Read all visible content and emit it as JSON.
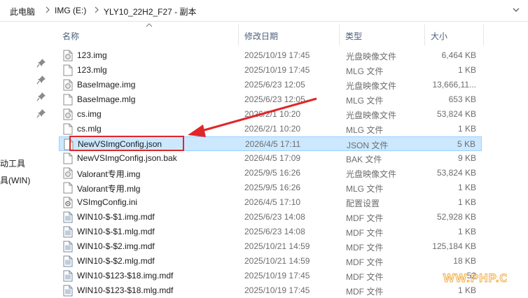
{
  "address_bar": {
    "crumbs": [
      "此电脑",
      "IMG (E:)",
      "YLY10_22H2_F27 - 副本"
    ],
    "separator_icon": "chevron-right-icon",
    "dropdown_icon": "chevron-down-icon"
  },
  "nav_pane": {
    "items": [
      "启动工具",
      "工具(WIN)"
    ],
    "pin_icon": "pin-icon"
  },
  "columns": {
    "name": "名称",
    "date": "修改日期",
    "type": "类型",
    "size": "大小"
  },
  "files": [
    {
      "name": "123.img",
      "date": "2025/10/19 17:45",
      "type": "光盘映像文件",
      "size": "6,464 KB",
      "icon": "disc-image-file-icon"
    },
    {
      "name": "123.mlg",
      "date": "2025/10/19 17:45",
      "type": "MLG 文件",
      "size": "1 KB",
      "icon": "blank-file-icon"
    },
    {
      "name": "BaseImage.img",
      "date": "2025/6/23 12:05",
      "type": "光盘映像文件",
      "size": "13,666,11...",
      "icon": "disc-image-file-icon"
    },
    {
      "name": "BaseImage.mlg",
      "date": "2025/6/23 12:05",
      "type": "MLG 文件",
      "size": "653 KB",
      "icon": "blank-file-icon"
    },
    {
      "name": "cs.img",
      "date": "2026/2/1 10:20",
      "type": "光盘映像文件",
      "size": "53,824 KB",
      "icon": "disc-image-file-icon"
    },
    {
      "name": "cs.mlg",
      "date": "2026/2/1 10:20",
      "type": "MLG 文件",
      "size": "1 KB",
      "icon": "blank-file-icon"
    },
    {
      "name": "NewVSImgConfig.json",
      "date": "2026/4/5 17:11",
      "type": "JSON 文件",
      "size": "5 KB",
      "icon": "blank-file-icon",
      "selected": true
    },
    {
      "name": "NewVSImgConfig.json.bak",
      "date": "2026/4/5 17:09",
      "type": "BAK 文件",
      "size": "9 KB",
      "icon": "blank-file-icon"
    },
    {
      "name": "Valorant专用.img",
      "date": "2025/9/5 16:26",
      "type": "光盘映像文件",
      "size": "53,824 KB",
      "icon": "disc-image-file-icon"
    },
    {
      "name": "Valorant专用.mlg",
      "date": "2025/9/5 16:26",
      "type": "MLG 文件",
      "size": "1 KB",
      "icon": "blank-file-icon"
    },
    {
      "name": "VSImgConfig.ini",
      "date": "2026/4/5 17:10",
      "type": "配置设置",
      "size": "1 KB",
      "icon": "config-file-icon"
    },
    {
      "name": "WIN10-$-$1.img.mdf",
      "date": "2025/6/23 14:08",
      "type": "MDF 文件",
      "size": "52,928 KB",
      "icon": "mdf-file-icon"
    },
    {
      "name": "WIN10-$-$1.mlg.mdf",
      "date": "2025/6/23 14:08",
      "type": "MDF 文件",
      "size": "1 KB",
      "icon": "mdf-file-icon"
    },
    {
      "name": "WIN10-$-$2.img.mdf",
      "date": "2025/10/21 14:59",
      "type": "MDF 文件",
      "size": "125,184 KB",
      "icon": "mdf-file-icon"
    },
    {
      "name": "WIN10-$-$2.mlg.mdf",
      "date": "2025/10/21 14:59",
      "type": "MDF 文件",
      "size": "18 KB",
      "icon": "mdf-file-icon"
    },
    {
      "name": "WIN10-$123-$18.img.mdf",
      "date": "2025/10/19 17:45",
      "type": "MDF 文件",
      "size": "52",
      "icon": "mdf-file-icon"
    },
    {
      "name": "WIN10-$123-$18.mlg.mdf",
      "date": "2025/10/19 17:45",
      "type": "MDF 文件",
      "size": "1 KB",
      "icon": "mdf-file-icon"
    }
  ],
  "annotation": {
    "color": "#e0262a"
  },
  "watermark": {
    "text": "WWW.PHP.CN"
  },
  "colors": {
    "selection_bg": "#cce8ff",
    "selection_border": "#99d1ff",
    "header_text": "#4c607a"
  }
}
